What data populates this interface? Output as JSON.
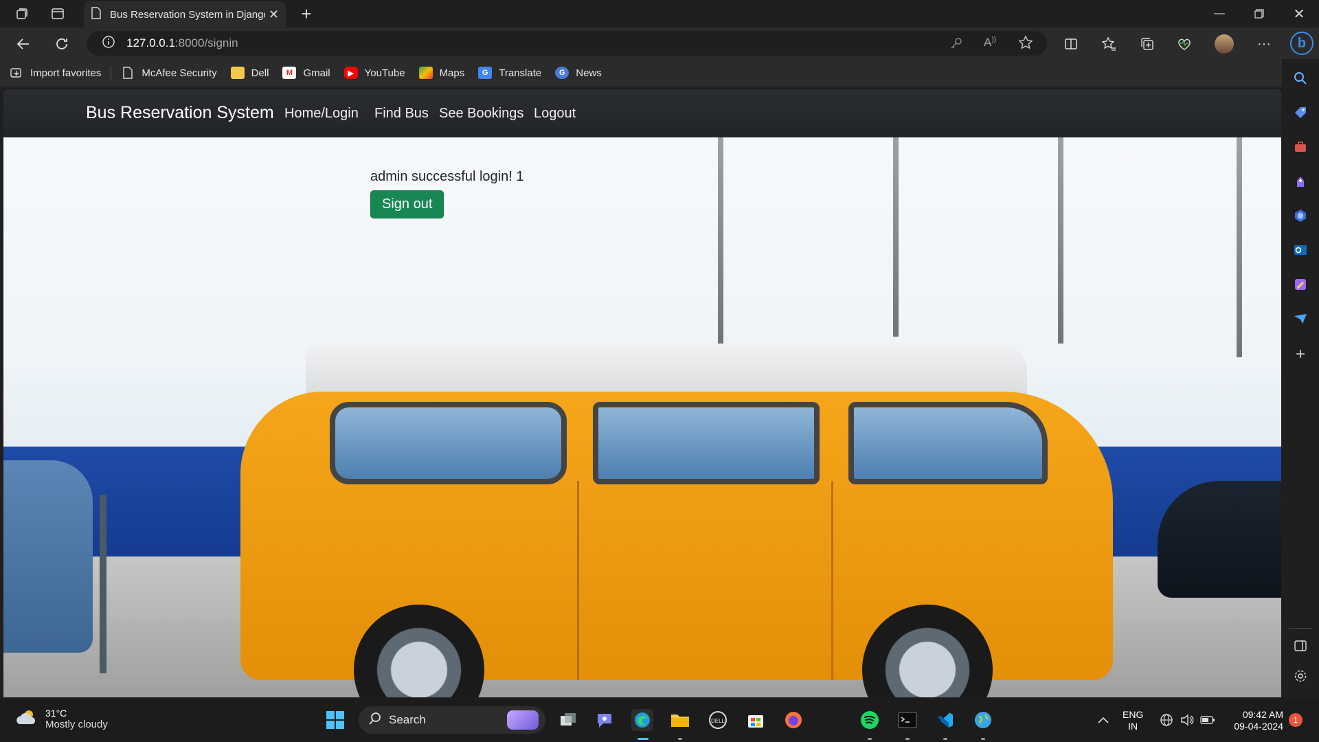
{
  "browser": {
    "tab_title": "Bus Reservation System in Django",
    "url_host": "127.0.0.1",
    "url_path": ":8000/signin",
    "bookmarks": [
      {
        "label": "Import favorites",
        "icon": "import-icon"
      },
      {
        "label": "McAfee Security",
        "icon": "page-icon"
      },
      {
        "label": "Dell",
        "icon": "folder-icon"
      },
      {
        "label": "Gmail",
        "icon": "gmail-icon"
      },
      {
        "label": "YouTube",
        "icon": "youtube-icon"
      },
      {
        "label": "Maps",
        "icon": "maps-icon"
      },
      {
        "label": "Translate",
        "icon": "translate-icon"
      },
      {
        "label": "News",
        "icon": "news-icon"
      }
    ]
  },
  "site": {
    "brand": "Bus Reservation System",
    "nav": [
      "Home/Login",
      "Find Bus",
      "See Bookings",
      "Logout"
    ],
    "message": "admin successful login! 1",
    "signout_label": "Sign out",
    "accent": "#198754"
  },
  "taskbar": {
    "temperature": "31°C",
    "weather": "Mostly cloudy",
    "search_label": "Search",
    "lang_top": "ENG",
    "lang_bottom": "IN",
    "time": "09:42 AM",
    "date": "09-04-2024",
    "notification_count": "1"
  }
}
